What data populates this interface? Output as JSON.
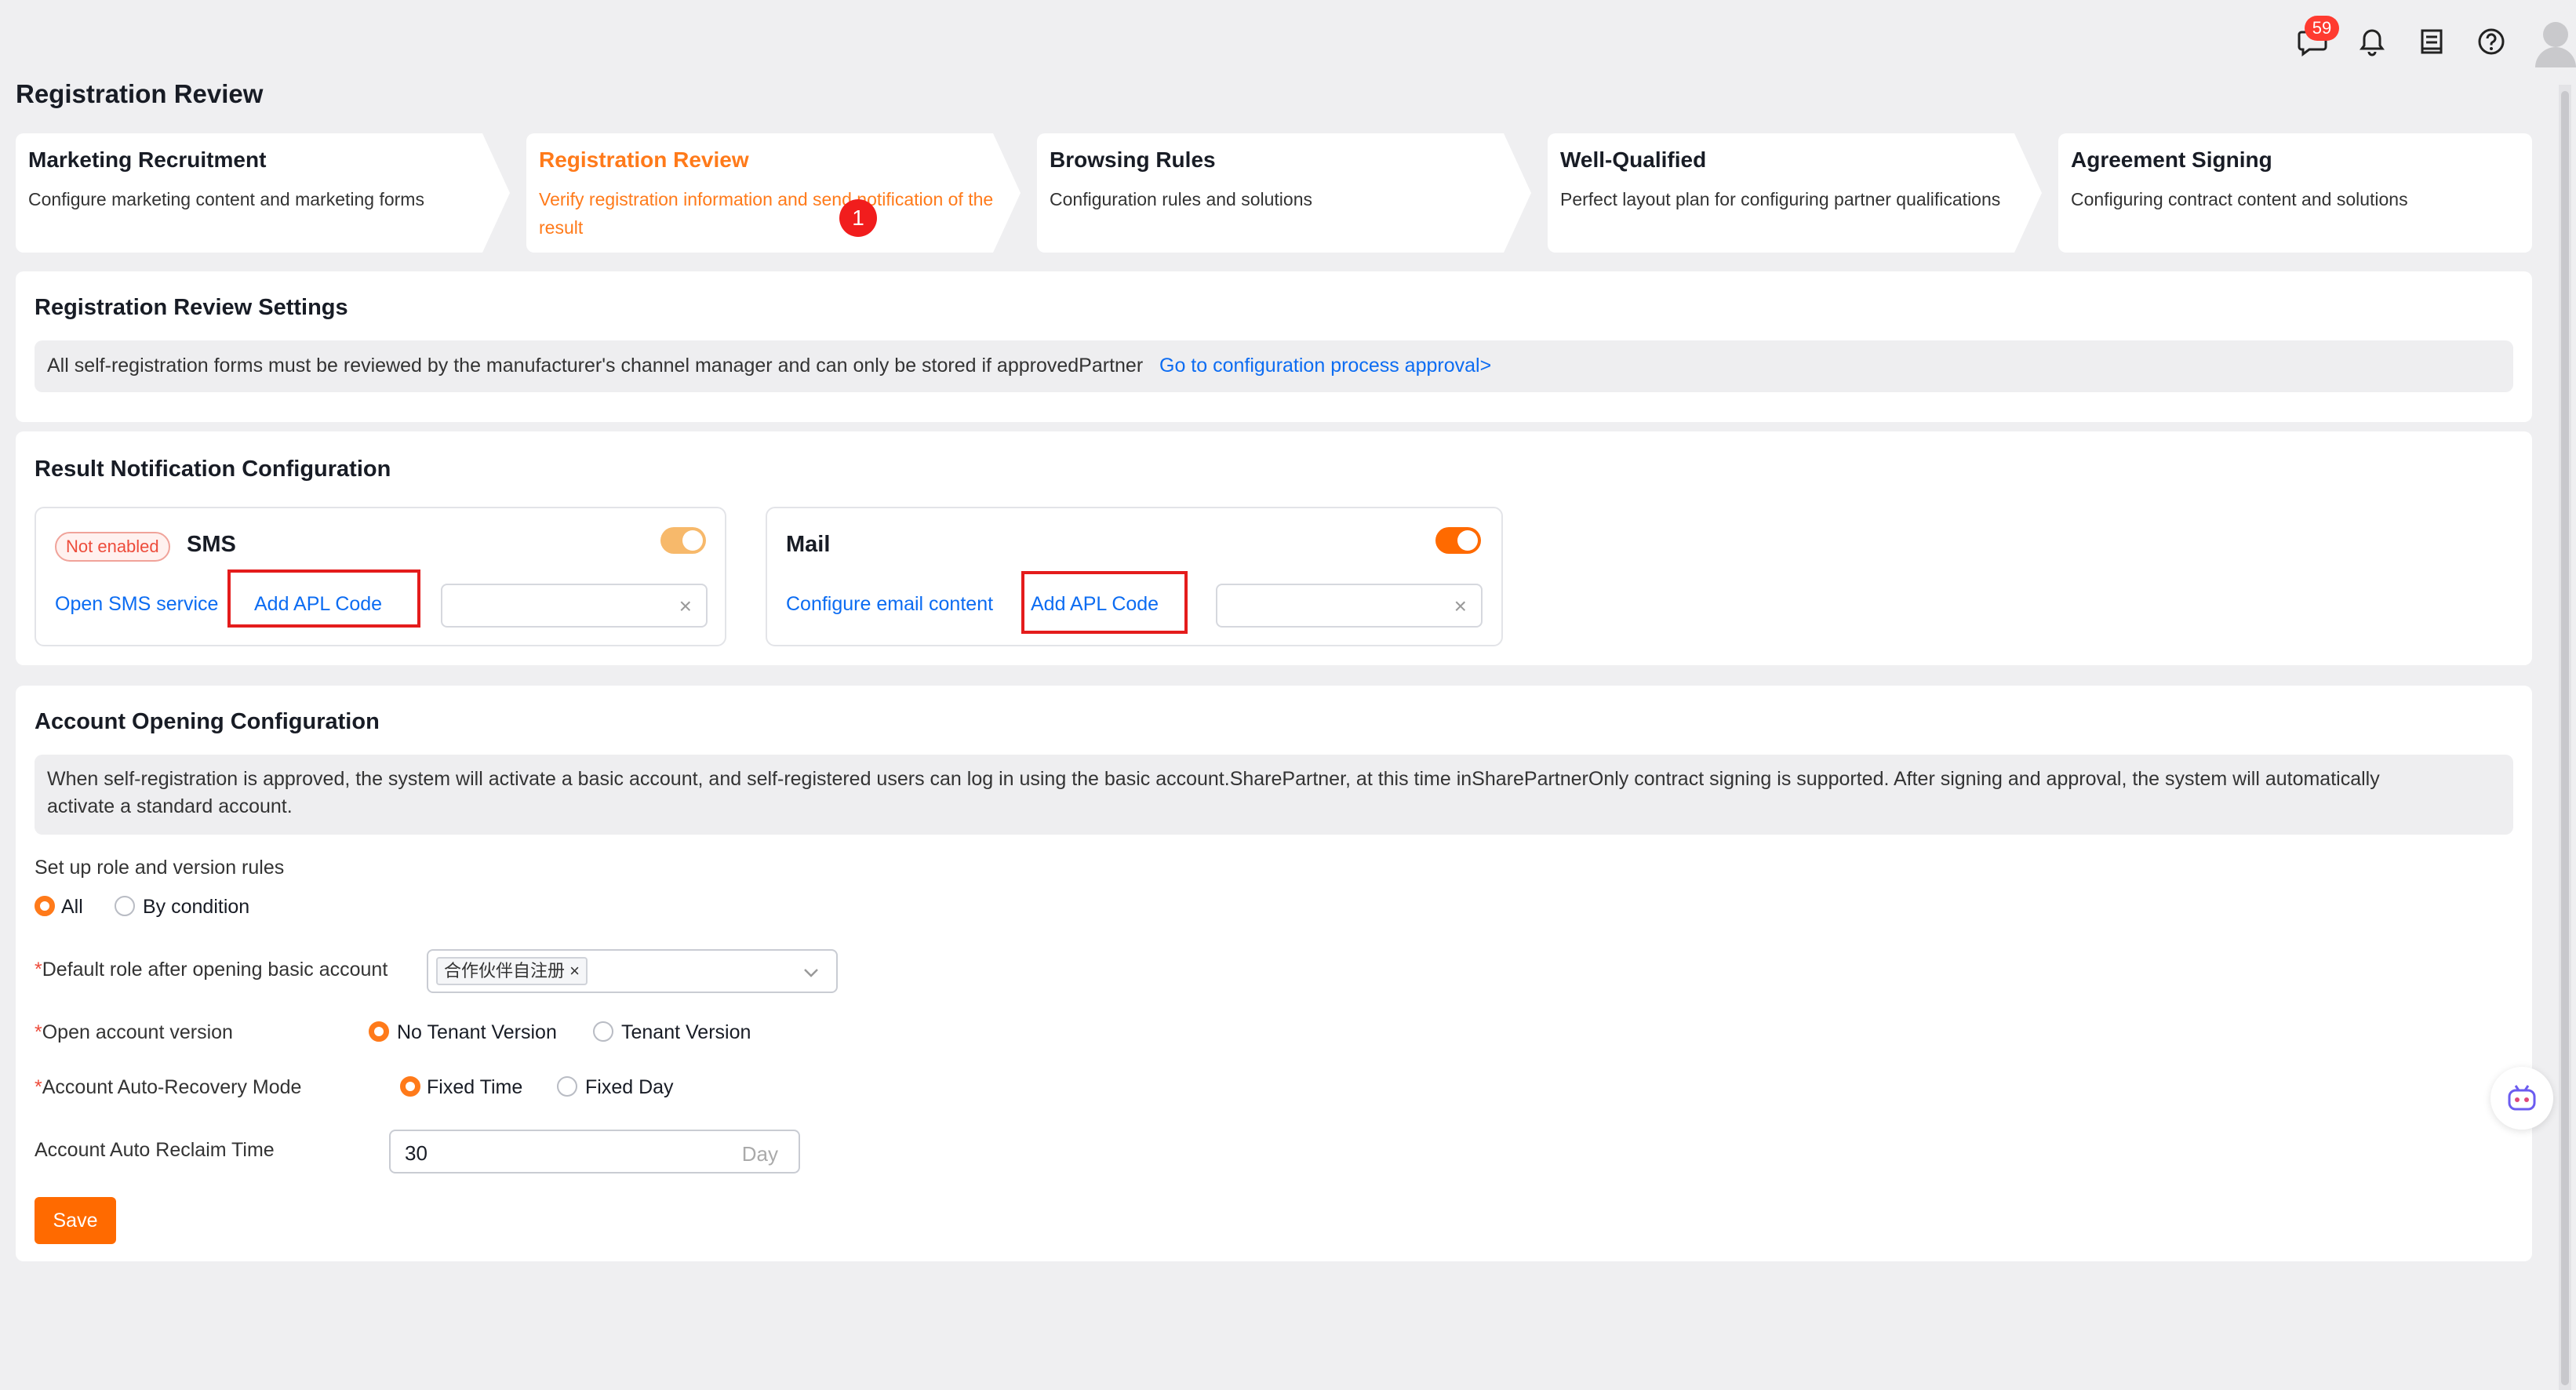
{
  "topbar": {
    "message_badge": "59",
    "icons": [
      "chat-icon",
      "bell-icon",
      "book-icon",
      "help-icon",
      "avatar"
    ]
  },
  "page_title": "Registration Review",
  "steps": [
    {
      "title": "Marketing Recruitment",
      "desc": "Configure marketing content and marketing forms",
      "active": false
    },
    {
      "title": "Registration Review",
      "desc": "Verify registration information and send notification of the result",
      "active": true
    },
    {
      "title": "Browsing Rules",
      "desc": "Configuration rules and solutions",
      "active": false
    },
    {
      "title": "Well-Qualified",
      "desc": "Perfect layout plan for configuring partner qualifications",
      "active": false
    },
    {
      "title": "Agreement Signing",
      "desc": "Configuring contract content and solutions",
      "active": false
    }
  ],
  "step_marker": "1",
  "review_settings": {
    "title": "Registration Review Settings",
    "notice": "All self-registration forms must be reviewed by the manufacturer's channel manager and can only be stored if approvedPartner",
    "link": "Go to configuration process approval>"
  },
  "notification": {
    "title": "Result Notification Configuration",
    "sms": {
      "status_tag": "Not enabled",
      "title": "SMS",
      "enabled": true,
      "link1": "Open SMS service",
      "link2": "Add APL Code"
    },
    "mail": {
      "title": "Mail",
      "enabled": true,
      "link1": "Configure email content",
      "link2": "Add APL Code"
    },
    "clear_icon": "×"
  },
  "account": {
    "title": "Account Opening Configuration",
    "notice_line1": "When self-registration is approved, the system will activate a basic account, and self-registered users can log in using the basic account.SharePartner, at this time inSharePartnerOnly contract signing is supported. After signing and approval, the system will automatically",
    "notice_line2": "activate a standard account.",
    "rules_label": "Set up role and version rules",
    "rules_options": [
      "All",
      "By condition"
    ],
    "rules_selected": "All",
    "required_mark": "*",
    "default_role_label": "Default role after opening basic account",
    "default_role_chip": "合作伙伴自注册 ×",
    "version_label": "Open account version",
    "version_options": [
      "No Tenant Version",
      "Tenant Version"
    ],
    "version_selected": "No Tenant Version",
    "recovery_label": "Account Auto-Recovery Mode",
    "recovery_options": [
      "Fixed Time",
      "Fixed Day"
    ],
    "recovery_selected": "Fixed Time",
    "reclaim_label": "Account Auto Reclaim Time",
    "reclaim_value": "30",
    "reclaim_unit": "Day",
    "save_label": "Save"
  },
  "colors": {
    "accent": "#ff6a00",
    "link": "#0c6cf2",
    "toggle_sms": "#f7b96b",
    "toggle_mail": "#ff6a00",
    "highlight": "#e41c1c"
  }
}
